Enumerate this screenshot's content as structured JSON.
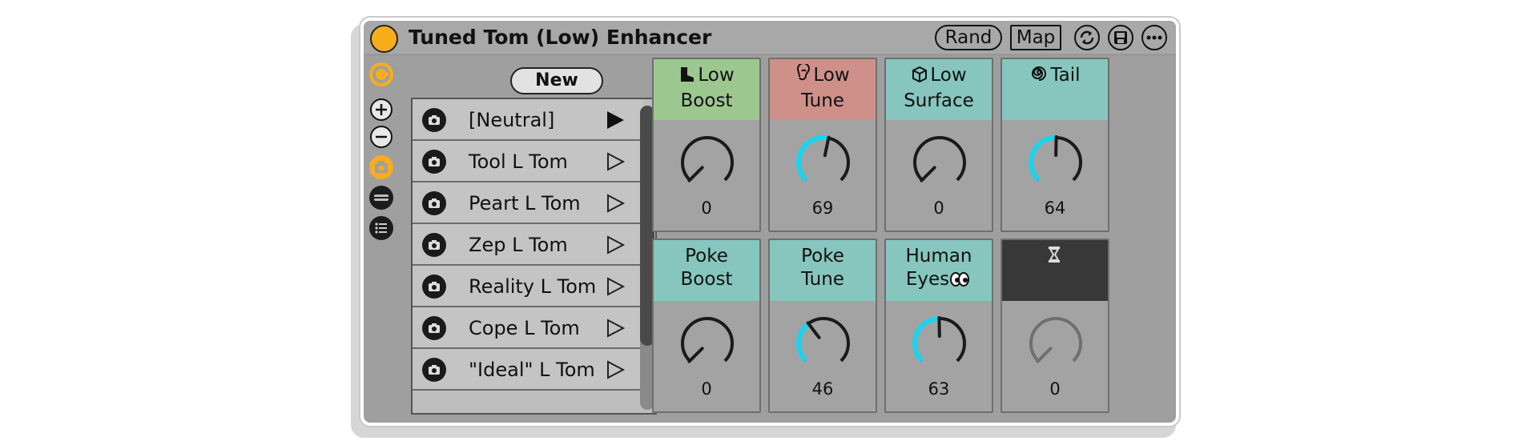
{
  "device": {
    "title": "Tuned Tom (Low) Enhancer",
    "power": "on",
    "rand_label": "Rand",
    "map_label": "Map"
  },
  "presets": {
    "new_label": "New",
    "items": [
      {
        "name": "[Neutral]",
        "active": true
      },
      {
        "name": "Tool L Tom",
        "active": false
      },
      {
        "name": "Peart L Tom",
        "active": false
      },
      {
        "name": "Zep L Tom",
        "active": false
      },
      {
        "name": "Reality L Tom",
        "active": false
      },
      {
        "name": "Cope L Tom",
        "active": false
      },
      {
        "name": "\"Ideal\" L Tom",
        "active": false
      }
    ]
  },
  "macros": [
    {
      "line1": "Low",
      "line2": "Boost",
      "icon": "boot-icon",
      "value": 0,
      "color": "#9cc78f",
      "enabled": true
    },
    {
      "line1": "Low",
      "line2": "Tune",
      "icon": "ear-icon",
      "value": 69,
      "color": "#cf9089",
      "enabled": true
    },
    {
      "line1": "Low",
      "line2": "Surface",
      "icon": "cube-icon",
      "value": 0,
      "color": "#86c6be",
      "enabled": true
    },
    {
      "line1": "Tail",
      "line2": "",
      "icon": "spiral-icon",
      "value": 64,
      "color": "#86c6be",
      "enabled": true
    },
    {
      "line1": "Poke",
      "line2": "Boost",
      "icon": "",
      "value": 0,
      "color": "#86c6be",
      "enabled": true
    },
    {
      "line1": "Poke",
      "line2": "Tune",
      "icon": "",
      "value": 46,
      "color": "#86c6be",
      "enabled": true
    },
    {
      "line1": "Human",
      "line2": "Eyes",
      "icon": "eyes-icon",
      "value": 63,
      "color": "#86c6be",
      "enabled": true
    },
    {
      "line1": "",
      "line2": "",
      "icon": "hourglass-icon",
      "value": 0,
      "color": "#383838",
      "enabled": false
    }
  ],
  "colors": {
    "accent": "#f8ad1c",
    "knob_arc": "#19d4f0"
  }
}
